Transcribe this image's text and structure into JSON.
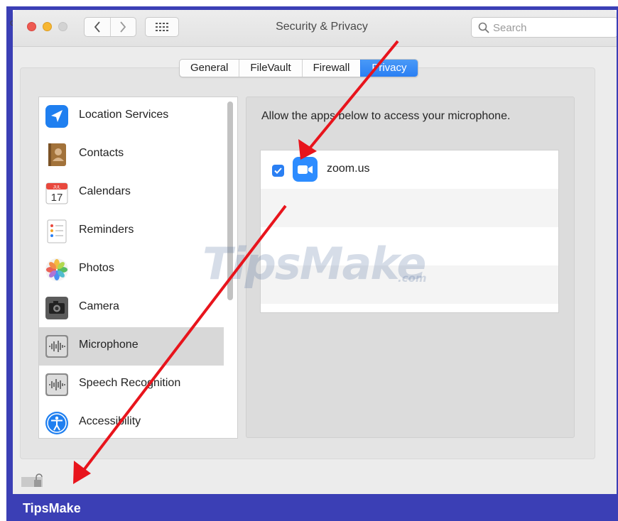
{
  "window": {
    "title": "Security & Privacy"
  },
  "search": {
    "placeholder": "Search"
  },
  "tabs": [
    {
      "label": "General",
      "active": false
    },
    {
      "label": "FileVault",
      "active": false
    },
    {
      "label": "Firewall",
      "active": false
    },
    {
      "label": "Privacy",
      "active": true
    }
  ],
  "sidebar": {
    "items": [
      {
        "label": "Location Services",
        "icon": "location-icon"
      },
      {
        "label": "Contacts",
        "icon": "contacts-icon"
      },
      {
        "label": "Calendars",
        "icon": "calendar-icon",
        "icon_text": "17",
        "icon_month": "JUL"
      },
      {
        "label": "Reminders",
        "icon": "reminders-icon"
      },
      {
        "label": "Photos",
        "icon": "photos-icon"
      },
      {
        "label": "Camera",
        "icon": "camera-icon"
      },
      {
        "label": "Microphone",
        "icon": "microphone-icon",
        "selected": true
      },
      {
        "label": "Speech Recognition",
        "icon": "speech-recognition-icon"
      },
      {
        "label": "Accessibility",
        "icon": "accessibility-icon"
      }
    ]
  },
  "main": {
    "description": "Allow the apps below to access your microphone.",
    "apps": [
      {
        "name": "zoom.us",
        "checked": true,
        "icon": "zoom-icon"
      }
    ]
  },
  "watermark": {
    "text": "TipsMake",
    "suffix": ".com"
  },
  "banner": {
    "text": "TipsMake"
  },
  "stray_char": "c",
  "colors": {
    "accent": "#2a7ff3",
    "frame": "#3b3fb5",
    "arrow": "#e8141c"
  }
}
